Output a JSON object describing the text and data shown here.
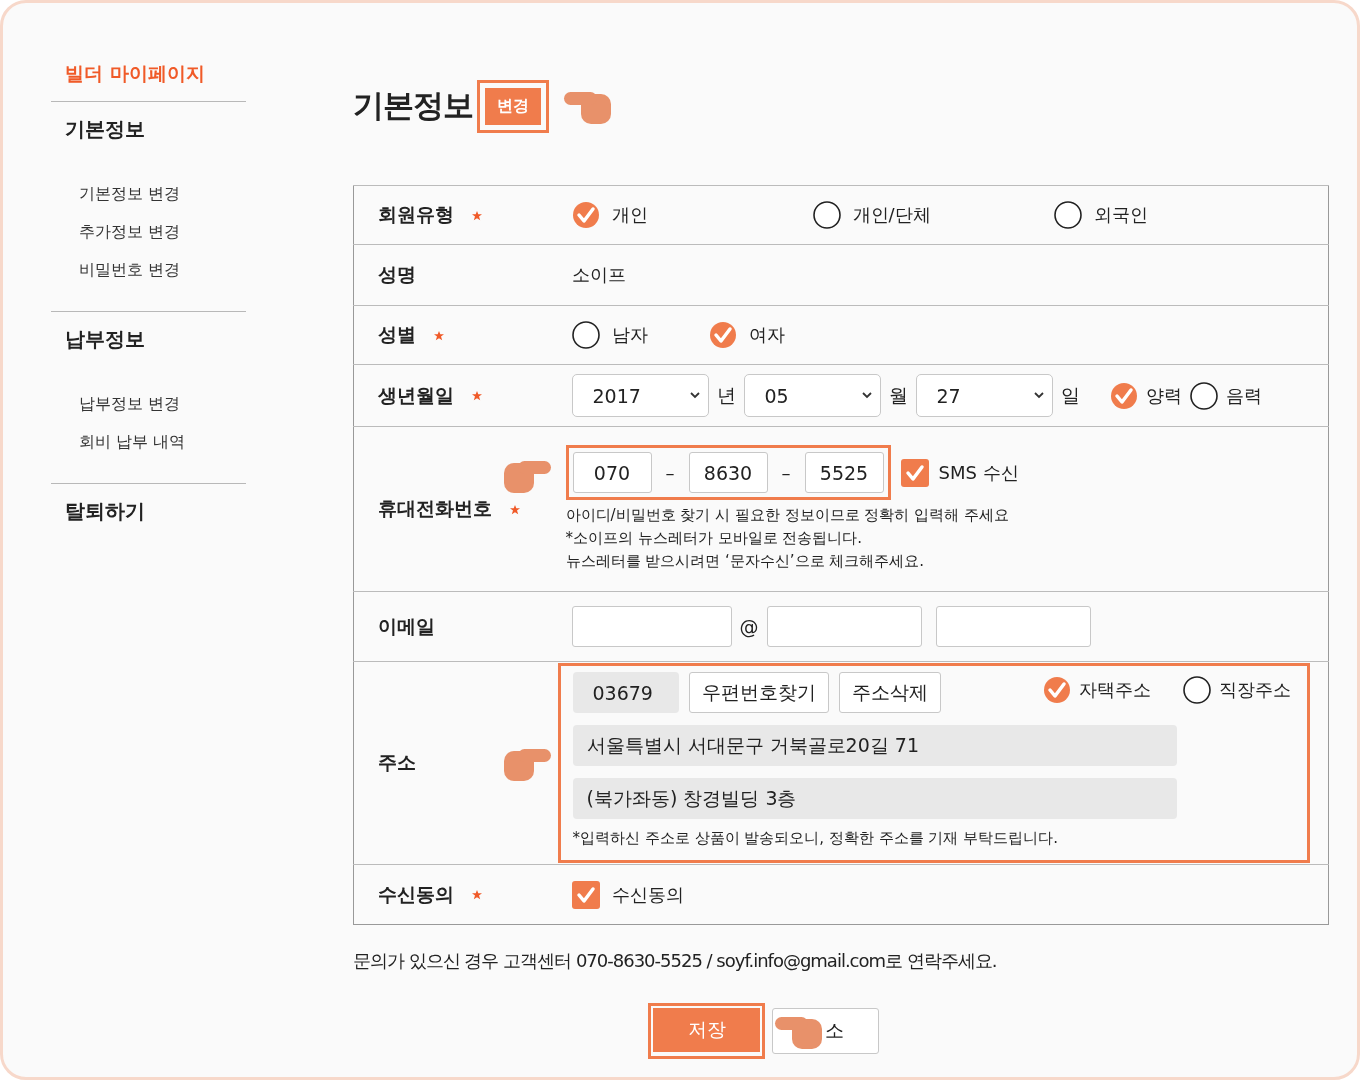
{
  "sidebar": {
    "title": "빌더 마이페이지",
    "sections": [
      {
        "heading": "기본정보",
        "items": [
          "기본정보 변경",
          "추가정보 변경",
          "비밀번호 변경"
        ]
      },
      {
        "heading": "납부정보",
        "items": [
          "납부정보 변경",
          "회비 납부 내역"
        ]
      },
      {
        "heading": "탈퇴하기"
      }
    ]
  },
  "header": {
    "title": "기본정보",
    "edit_button": "변경",
    "highlighted": true
  },
  "form": {
    "rows": [
      {
        "kind": "radio",
        "label": "회원유형",
        "required": true,
        "options": [
          {
            "label": "개인",
            "selected": true
          },
          {
            "label": "개인/단체",
            "selected": false
          },
          {
            "label": "외국인",
            "selected": false
          }
        ]
      },
      {
        "kind": "text",
        "label": "성명",
        "value": "소이프"
      },
      {
        "kind": "radio",
        "label": "성별",
        "required": true,
        "options": [
          {
            "label": "남자",
            "selected": false
          },
          {
            "label": "여자",
            "selected": true
          }
        ]
      },
      {
        "kind": "date",
        "label": "생년월일",
        "required": true,
        "selects": [
          {
            "value": "2017",
            "unit": "년"
          },
          {
            "value": "05",
            "unit": "월"
          },
          {
            "value": "27",
            "unit": "일"
          }
        ],
        "options": [
          {
            "label": "양력",
            "selected": true
          },
          {
            "label": "음력",
            "selected": false
          }
        ]
      },
      {
        "kind": "phone",
        "label": "휴대전화번호",
        "required": true,
        "highlighted": true,
        "parts": [
          "070",
          "8630",
          "5525"
        ],
        "separators": [
          "–",
          "–"
        ],
        "sms": {
          "label": "SMS 수신",
          "checked": true
        },
        "notes": [
          "아이디/비밀번호 찾기 시 필요한 정보이므로 정확히 입력해 주세요",
          "*소이프의 뉴스레터가 모바일로 전송됩니다.",
          "뉴스레터를 받으시려면 ‘문자수신’으로 체크해주세요."
        ]
      },
      {
        "kind": "email",
        "label": "이메일",
        "at": "@"
      },
      {
        "kind": "address",
        "label": "주소",
        "highlighted": true,
        "postcode": "03679",
        "buttons": [
          "우편번호찾기",
          "주소삭제"
        ],
        "options": [
          {
            "label": "자택주소",
            "selected": true
          },
          {
            "label": "직장주소",
            "selected": false
          }
        ],
        "lines": [
          "서울특별시 서대문구 거북골로20길 71",
          "(북가좌동) 창경빌딩 3층"
        ],
        "note": "*입력하신 주소로 상품이 발송되오니, 정확한 주소를 기재 부탁드립니다."
      },
      {
        "kind": "checkbox",
        "label": "수신동의",
        "required": true,
        "check": {
          "label": "수신동의",
          "checked": true
        }
      }
    ]
  },
  "notice": "문의가 있으신 경우 고객센터 070-8630-5525 / soyf.info@gmail.com로 연락주세요.",
  "buttons": [
    {
      "label": "저장",
      "kind": "primary",
      "highlighted": true
    },
    {
      "label": "소",
      "kind": "secondary"
    }
  ]
}
